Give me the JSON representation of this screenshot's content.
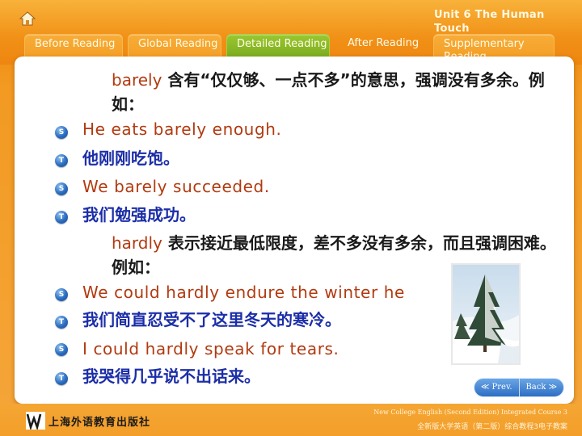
{
  "header": {
    "unit_title": "Unit 6 The Human Touch",
    "tabs": [
      {
        "label": "Before Reading",
        "active": false
      },
      {
        "label": "Global Reading",
        "active": false
      },
      {
        "label": "Detailed Reading",
        "active": true
      },
      {
        "label": "After Reading",
        "active": false
      },
      {
        "label": "Supplementary Reading",
        "active": false
      }
    ]
  },
  "content": {
    "barely_def": {
      "keyword": "barely",
      "text": " 含有“仅仅够、一点不多”的意思，强调没有多余。例如："
    },
    "lines_1": [
      {
        "marker": "S",
        "text": "He eats barely enough.",
        "lang": "en"
      },
      {
        "marker": "T",
        "text": "他刚刚吃饱。",
        "lang": "cn"
      },
      {
        "marker": "S",
        "text": "We barely succeeded.",
        "lang": "en"
      },
      {
        "marker": "T",
        "text": "我们勉强成功。",
        "lang": "cn"
      }
    ],
    "hardly_def": {
      "keyword": "hardly",
      "text": " 表示接近最低限度，差不多没有多余，而且强调困难。例如："
    },
    "lines_2": [
      {
        "marker": "S",
        "text": "We could hardly endure the winter he",
        "lang": "en"
      },
      {
        "marker": "T",
        "text": "我们简直忍受不了这里冬天的寒冷。",
        "lang": "cn"
      },
      {
        "marker": "S",
        "text": "I could hardly speak for tears.",
        "lang": "en"
      },
      {
        "marker": "T",
        "text": "我哭得几乎说不出话来。",
        "lang": "cn"
      }
    ],
    "photo_icon": "snowy-tree-photo"
  },
  "nav": {
    "prev_label": "≪ Prev.",
    "back_label": "Back ≫"
  },
  "footer": {
    "logo_text": "上海外语教育出版社",
    "en_line": "New College English (Second Edition) Integrated Course 3",
    "cn_line": "全新版大学英语（第二版）综合教程3电子教案"
  },
  "colors": {
    "english_text": "#b23a10",
    "chinese_text": "#1c2ea8",
    "active_tab": "#7fb024",
    "tab": "#f39a20"
  }
}
